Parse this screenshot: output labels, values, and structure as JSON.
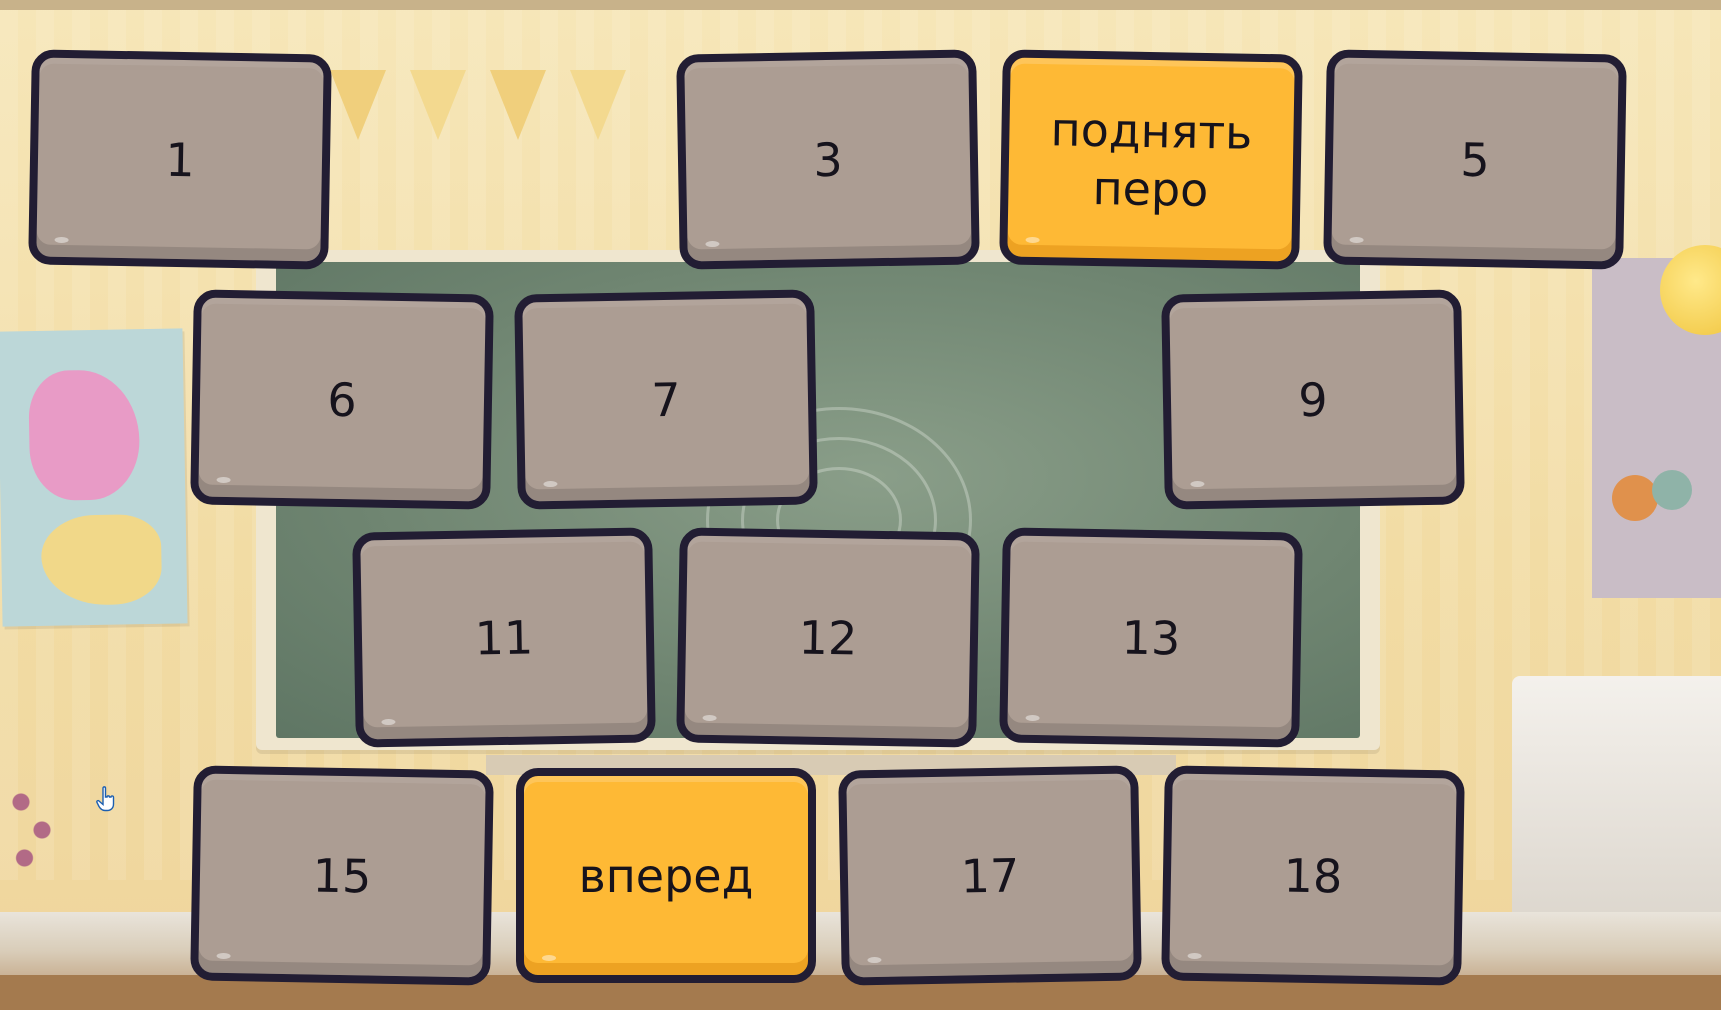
{
  "grid": {
    "row1": [
      {
        "label": "1",
        "highlight": false
      },
      {
        "label": "3",
        "highlight": false
      },
      {
        "label": "поднять\nперо",
        "highlight": true
      },
      {
        "label": "5",
        "highlight": false
      }
    ],
    "row2": [
      {
        "label": "6",
        "highlight": false
      },
      {
        "label": "7",
        "highlight": false
      },
      {
        "label": "9",
        "highlight": false
      }
    ],
    "row3": [
      {
        "label": "11",
        "highlight": false
      },
      {
        "label": "12",
        "highlight": false
      },
      {
        "label": "13",
        "highlight": false
      }
    ],
    "row4": [
      {
        "label": "15",
        "highlight": false
      },
      {
        "label": "вперед",
        "highlight": true
      },
      {
        "label": "17",
        "highlight": false
      },
      {
        "label": "18",
        "highlight": false
      }
    ]
  },
  "colors": {
    "tile_default": "#ac9d93",
    "tile_highlight": "#feb935",
    "tile_border": "#221d33"
  },
  "icons": {
    "cursor": "hand-pointer-icon"
  }
}
